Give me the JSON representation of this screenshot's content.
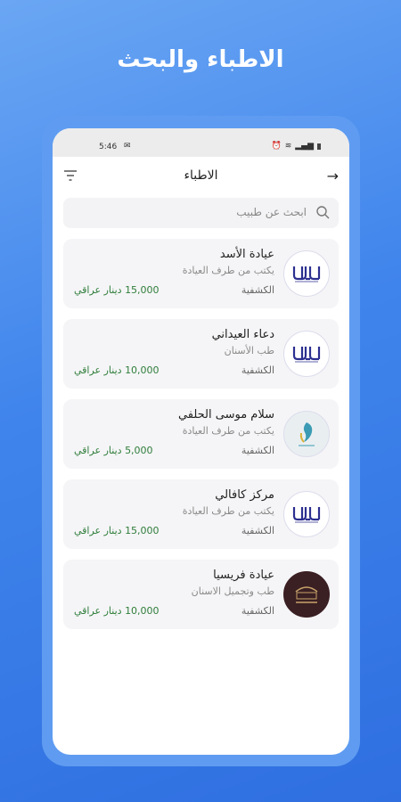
{
  "promo": {
    "title": "الاطباء والبحث"
  },
  "status_bar": {
    "time": "5:46",
    "left_icon": "notification-icon",
    "right_icons": [
      "alarm-icon",
      "wifi-icon",
      "signal-icon",
      "battery-icon"
    ]
  },
  "header": {
    "title": "الاطباء",
    "back_icon": "arrow-right-icon",
    "filter_icon": "filter-icon"
  },
  "search": {
    "placeholder": "ابحث عن طبيب"
  },
  "doctors": [
    {
      "name": "عيادة الأسد",
      "subtitle": "يكتب من طرف العيادة",
      "fee_label": "الكشفية",
      "price": "15,000 دينار عراقي",
      "avatar": "clinic-logo-icon"
    },
    {
      "name": "دعاء العيداني",
      "subtitle": "طب الأسنان",
      "fee_label": "الكشفية",
      "price": "10,000 دينار عراقي",
      "avatar": "clinic-logo-icon"
    },
    {
      "name": "سلام موسى الحلفي",
      "subtitle": "يكتب من طرف العيادة",
      "fee_label": "الكشفية",
      "price": "5,000 دينار عراقي",
      "avatar": "bird-logo-icon"
    },
    {
      "name": "مركز كافالي",
      "subtitle": "يكتب من طرف العيادة",
      "fee_label": "الكشفية",
      "price": "15,000 دينار عراقي",
      "avatar": "clinic-logo-icon"
    },
    {
      "name": "عيادة فريسيا",
      "subtitle": "طب وتجميل الاسنان",
      "fee_label": "الكشفية",
      "price": "10,000 دينار عراقي",
      "avatar": "freesia-logo-icon"
    }
  ],
  "colors": {
    "accent": "#3f84ec",
    "price": "#2f7d3a",
    "card_bg": "#f5f5f7"
  }
}
